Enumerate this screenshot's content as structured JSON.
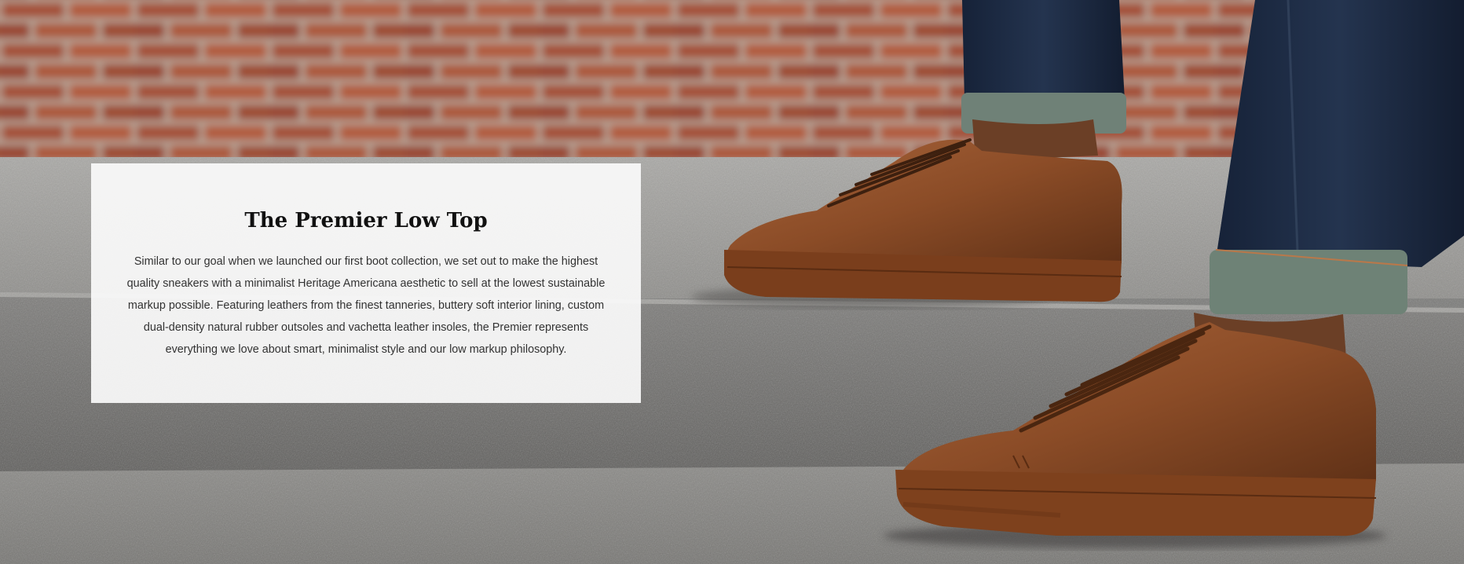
{
  "hero": {
    "image_description_icon": "sneaker-photo",
    "card": {
      "title": "The Premier Low Top",
      "body": "Similar to our goal when we launched our first boot collection, we set out to make the highest quality sneakers with a minimalist Heritage Americana aesthetic to sell at the lowest sustainable markup possible. Featuring leathers from the finest tanneries, buttery soft interior lining, custom dual-density natural rubber outsoles and vachetta leather insoles, the Premier represents everything we love about smart, minimalist style and our low markup philosophy."
    }
  },
  "colors": {
    "brick": "#9a4a34",
    "concrete": "#8c8b88",
    "leather": "#8a4a22",
    "denim": "#1e2c42",
    "card_bg": "#fafafa"
  }
}
